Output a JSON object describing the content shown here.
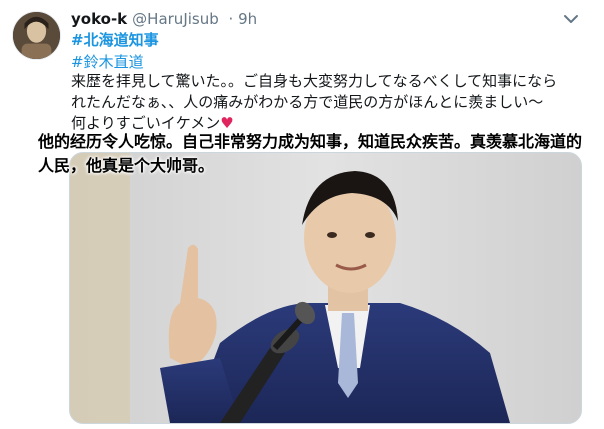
{
  "tweet": {
    "display_name": "yoko-k",
    "handle": "@HaruJisub",
    "time": "· 9h",
    "hashtags": [
      "#北海道知事",
      "#鈴木直道"
    ],
    "text_line1": "来歴を拝見して驚いた。。ご自身も大変努力してなるべくして知事になら",
    "text_line2": "れたんだなぁ、、人の痛みがわかる方で道民の方がほんとに羨ましい〜",
    "text_line3": "何よりすごいイケメン",
    "heart": "♥",
    "caption_line1": "他的经历令人吃惊。自己非常努力成为知事，知道民众疾苦。真羡慕北海道的",
    "caption_line2": "人民，他真是个大帅哥。"
  },
  "colors": {
    "link": "#1b95e0",
    "heart": "#e0245e",
    "name": "#14171a",
    "secondary": "#657786"
  },
  "icons": {
    "more": "chevron-down-icon"
  }
}
